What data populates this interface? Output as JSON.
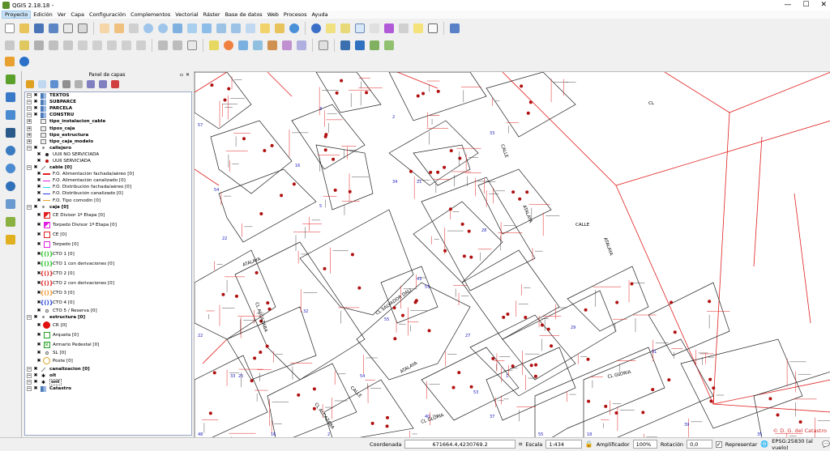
{
  "window": {
    "title": "QGIS 2.18.18 -",
    "minimize": "—",
    "maximize": "☐",
    "close": "✕"
  },
  "menu": [
    "Proyecto",
    "Edición",
    "Ver",
    "Capa",
    "Configuración",
    "Complementos",
    "Vectorial",
    "Ráster",
    "Base de datos",
    "Web",
    "Procesos",
    "Ayuda"
  ],
  "panel": {
    "title": "Panel de capas"
  },
  "layers": [
    {
      "label": "TEXTOS",
      "level": 0,
      "group": true,
      "checked": true,
      "sym": "grid"
    },
    {
      "label": "SUBPARCE",
      "level": 0,
      "group": true,
      "checked": true,
      "sym": "grid"
    },
    {
      "label": "PARCELA",
      "level": 0,
      "group": true,
      "checked": true,
      "sym": "grid"
    },
    {
      "label": "CONSTRU",
      "level": 0,
      "group": true,
      "checked": true,
      "sym": "grid"
    },
    {
      "label": "tipo_instalacion_cable",
      "level": 0,
      "group": true,
      "checked": false,
      "sym": "table"
    },
    {
      "label": "tipos_caja",
      "level": 0,
      "group": true,
      "checked": false,
      "sym": "table"
    },
    {
      "label": "tipo_estructura",
      "level": 0,
      "group": true,
      "checked": false,
      "sym": "table"
    },
    {
      "label": "tipo_caja_modelo",
      "level": 0,
      "group": true,
      "checked": false,
      "sym": "table"
    },
    {
      "label": "callejero",
      "level": 0,
      "group": true,
      "checked": true,
      "sym": "point"
    },
    {
      "label": "UUII NO SERVICIADA",
      "level": 1,
      "checked": true,
      "sym": "dot-black"
    },
    {
      "label": "UUII SERVICIADA",
      "level": 1,
      "checked": true,
      "sym": "dot-red"
    },
    {
      "label": "cable [0]",
      "level": 0,
      "group": true,
      "checked": true,
      "sym": "line"
    },
    {
      "label": "F.O. Alimentación fachada/aéreo [0]",
      "level": 1,
      "checked": true,
      "sym": "line-red"
    },
    {
      "label": "F.O. Alimentación canalizado [0]",
      "level": 1,
      "checked": true,
      "sym": "line-magenta"
    },
    {
      "label": "F.O. Distribución fachada/aéreo [0]",
      "level": 1,
      "checked": true,
      "sym": "line-cyan"
    },
    {
      "label": "F.O. Distribución canalizado [0]",
      "level": 1,
      "checked": true,
      "sym": "line-blue"
    },
    {
      "label": "F.O. Tipo comodín [0]",
      "level": 1,
      "checked": true,
      "sym": "line-orange"
    },
    {
      "label": "caja [0]",
      "level": 0,
      "group": true,
      "checked": true,
      "sym": "point"
    },
    {
      "label": "CE Divisor 1ª Etapa [0]",
      "level": 1,
      "checked": true,
      "sym": "tri-red",
      "tall": true
    },
    {
      "label": "Torpedo Divisor 1ª Etapa [0]",
      "level": 1,
      "checked": true,
      "sym": "tri-magenta",
      "tall": true
    },
    {
      "label": "CE [0]",
      "level": 1,
      "checked": true,
      "sym": "sq-red",
      "tall": true
    },
    {
      "label": "Torpedo [0]",
      "level": 1,
      "checked": true,
      "sym": "sq-magenta",
      "tall": true
    },
    {
      "label": "CTO 1 [0]",
      "level": 1,
      "checked": true,
      "sym": "br-green",
      "tall": true
    },
    {
      "label": "CTO 1 con derivaciones [0]",
      "level": 1,
      "checked": true,
      "sym": "br-green",
      "tall": true
    },
    {
      "label": "CTO 2 [0]",
      "level": 1,
      "checked": true,
      "sym": "br-red",
      "tall": true
    },
    {
      "label": "CTO 2 con derivaciones [0]",
      "level": 1,
      "checked": true,
      "sym": "br-red",
      "tall": true
    },
    {
      "label": "CTO 3 [0]",
      "level": 1,
      "checked": true,
      "sym": "br-orange",
      "tall": true
    },
    {
      "label": "CTO 4 [0]",
      "level": 1,
      "checked": true,
      "sym": "br-blue",
      "tall": true
    },
    {
      "label": "CTO 5 / Reserva [0]",
      "level": 1,
      "checked": true,
      "sym": "circ-small",
      "tall": false
    },
    {
      "label": "estructura [0]",
      "level": 0,
      "group": true,
      "checked": true,
      "sym": "point"
    },
    {
      "label": "CR [0]",
      "level": 1,
      "checked": true,
      "sym": "big-red-circle",
      "tall": true
    },
    {
      "label": "Arqueta [0]",
      "level": 1,
      "checked": true,
      "sym": "sq-green",
      "tall": true
    },
    {
      "label": "Armario Pedestal [0]",
      "level": 1,
      "checked": true,
      "sym": "x-green",
      "tall": true
    },
    {
      "label": "SL [0]",
      "level": 1,
      "checked": true,
      "sym": "circ-small",
      "tall": false
    },
    {
      "label": "Poste [0]",
      "level": 1,
      "checked": true,
      "sym": "circ-orange",
      "tall": true
    },
    {
      "label": "canalizacion [0]",
      "level": 0,
      "group": true,
      "checked": true,
      "sym": "line"
    },
    {
      "label": "olt",
      "level": 0,
      "group": true,
      "checked": true,
      "sym": "star"
    },
    {
      "label": "ont",
      "level": 0,
      "group": true,
      "checked": true,
      "sym": "star",
      "selected": true
    },
    {
      "label": "Catastro",
      "level": 0,
      "group": true,
      "checked": true,
      "sym": "grid"
    }
  ],
  "map": {
    "street_labels": [
      {
        "text": "ATALAYA"
      },
      {
        "text": "CL ALCAZABA"
      },
      {
        "text": "CL SALVADOR DALI"
      },
      {
        "text": "CALLE"
      },
      {
        "text": "ATALAYA"
      },
      {
        "text": "CALLE"
      },
      {
        "text": "ATALAYA"
      },
      {
        "text": "CL ALCAZABA"
      },
      {
        "text": "CL GLORIA"
      },
      {
        "text": "CL GLORIA"
      },
      {
        "text": "CALLE"
      },
      {
        "text": "ATALAYA"
      },
      {
        "text": "CL"
      }
    ],
    "copyright": "© D. G. del Catastro"
  },
  "status": {
    "coord_label": "Coordenada",
    "coord_value": "671664.4,4230769.2",
    "scale_label": "Escala",
    "scale_value": "1:434",
    "magnifier_label": "Amplificador",
    "magnifier_value": "100%",
    "rotation_label": "Rotación",
    "rotation_value": "0,0",
    "render_label": "Representar",
    "crs": "EPSG:25830 (al vuelo)"
  },
  "colors": {
    "parcel": "#e02020",
    "building": "#222222",
    "number": "#2020c0",
    "point": "#b01010",
    "selection": "#cce4f7"
  }
}
